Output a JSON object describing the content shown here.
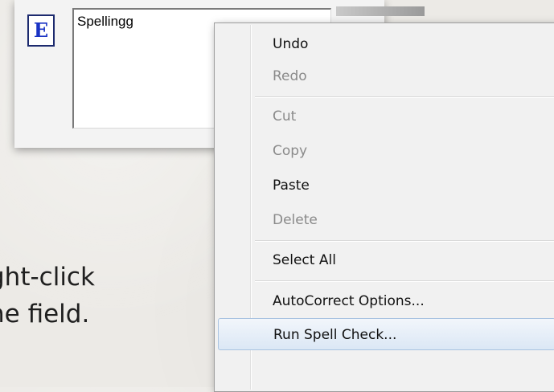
{
  "field": {
    "badge_letter": "E",
    "value": "Spellingg"
  },
  "instruction": {
    "line1": "ght-click",
    "line2": "ne field."
  },
  "context_menu": {
    "items": [
      {
        "label": "Undo",
        "enabled": true
      },
      {
        "label": "Redo",
        "enabled": false
      },
      {
        "label": "Cut",
        "enabled": false
      },
      {
        "label": "Copy",
        "enabled": false
      },
      {
        "label": "Paste",
        "enabled": true
      },
      {
        "label": "Delete",
        "enabled": false
      },
      {
        "label": "Select All",
        "enabled": true
      },
      {
        "label": "AutoCorrect Options...",
        "enabled": true
      },
      {
        "label": "Run Spell Check...",
        "enabled": true,
        "highlighted": true
      }
    ]
  },
  "colors": {
    "badge_letter": "#1a33c4",
    "highlight_border": "#a9c3e1",
    "disabled_text": "#8a8a8a"
  }
}
